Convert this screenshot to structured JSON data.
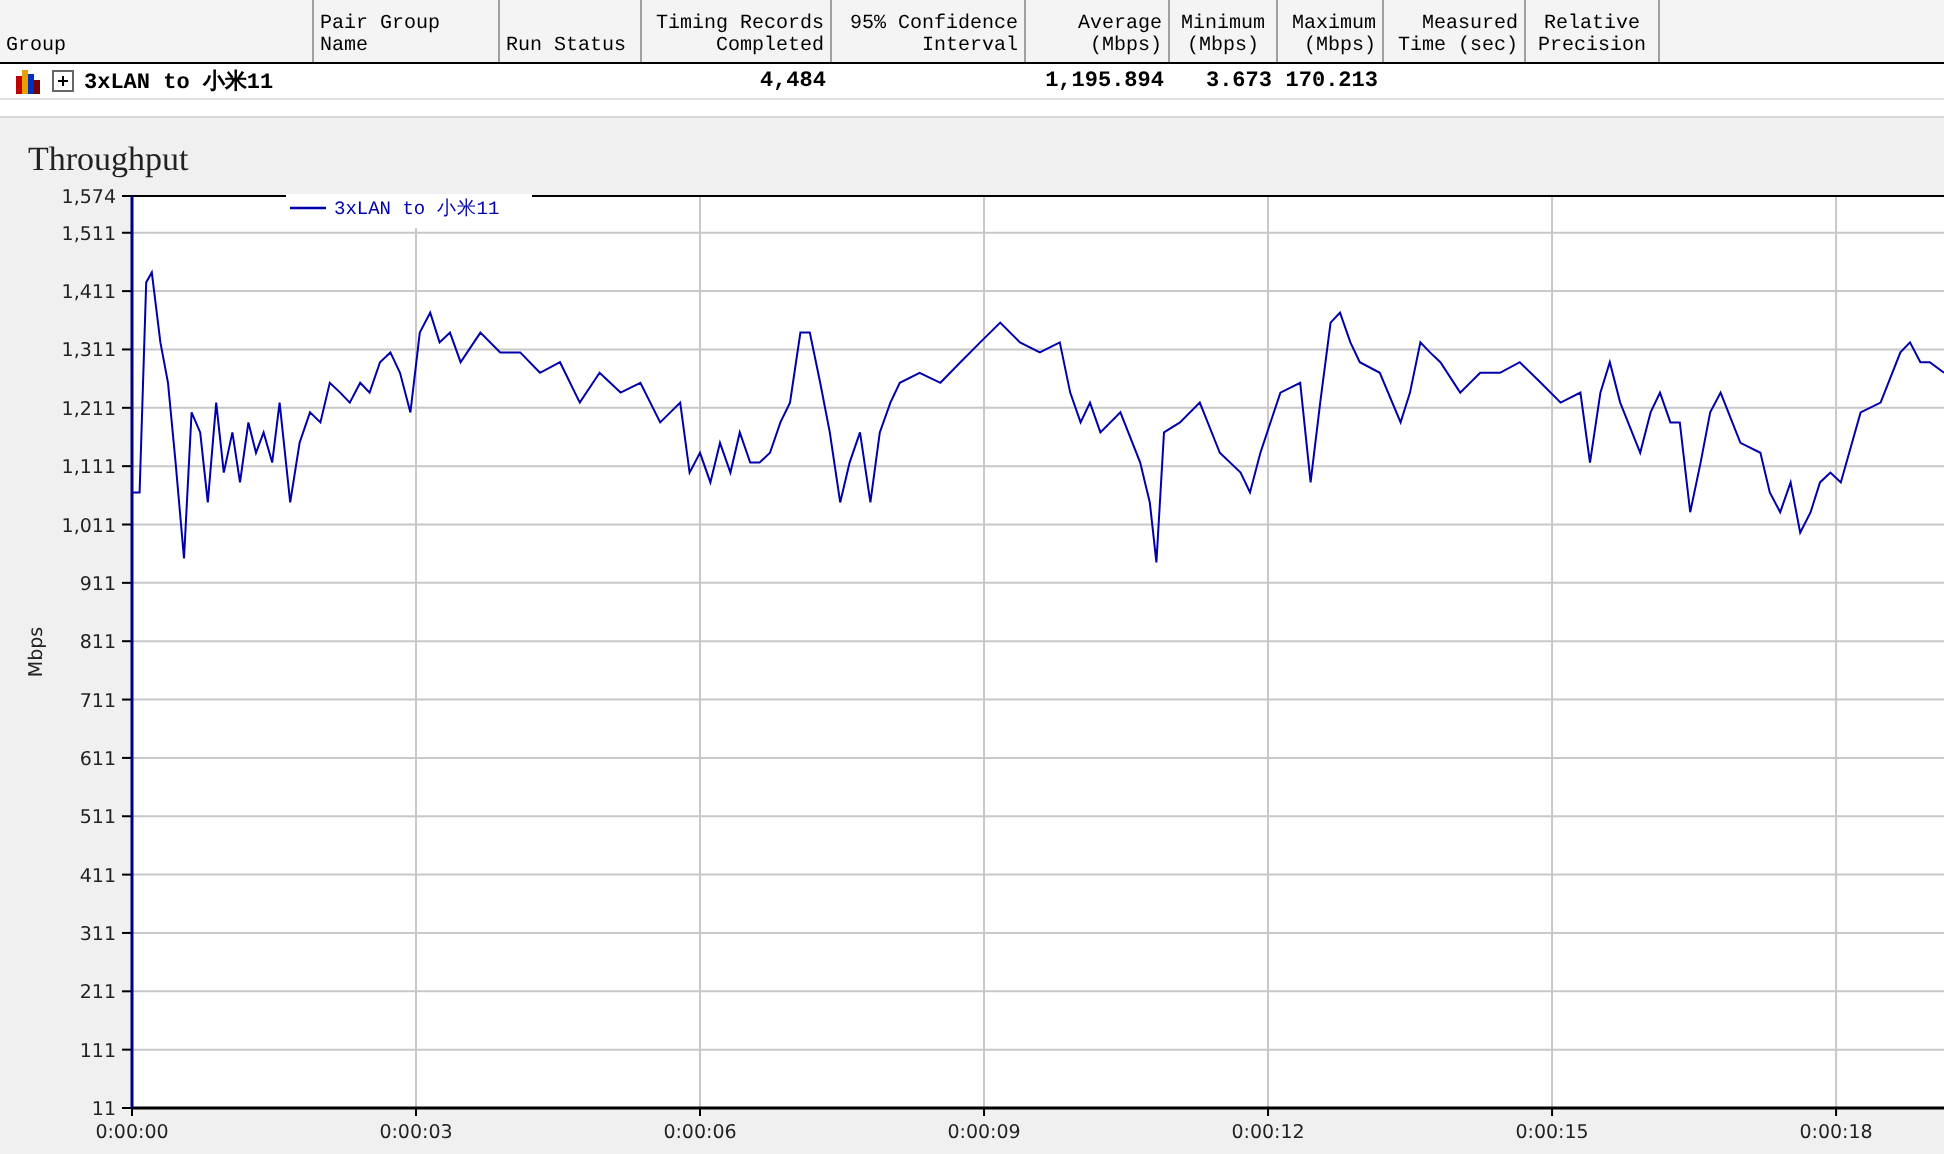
{
  "table": {
    "columns": [
      {
        "label": "Group"
      },
      {
        "label": "Pair Group\nName"
      },
      {
        "label": "Run Status"
      },
      {
        "label": "Timing Records\nCompleted"
      },
      {
        "label": "95% Confidence\nInterval"
      },
      {
        "label": "Average\n(Mbps)"
      },
      {
        "label": "Minimum\n(Mbps)"
      },
      {
        "label": "Maximum\n(Mbps)"
      },
      {
        "label": "Measured\nTime (sec)"
      },
      {
        "label": "Relative\nPrecision"
      }
    ],
    "rows": [
      {
        "group": "3xLAN to 小米11",
        "expanded": false,
        "timing_records": "4,484",
        "average": "1,195.894",
        "minimum": "3.673",
        "maximum": "170.213"
      }
    ]
  },
  "chart": {
    "chart_data": {
      "type": "line",
      "title": "Throughput",
      "ylabel": "Mbps",
      "grid": true,
      "x": [
        0,
        0.08,
        0.15,
        0.21,
        0.3,
        0.38,
        0.46,
        0.55,
        0.63,
        0.72,
        0.8,
        0.89,
        0.97,
        1.06,
        1.14,
        1.23,
        1.31,
        1.39,
        1.48,
        1.56,
        1.67,
        1.77,
        1.88,
        1.99,
        2.09,
        2.2,
        2.3,
        2.41,
        2.51,
        2.62,
        2.73,
        2.83,
        2.94,
        3.04,
        3.15,
        3.25,
        3.36,
        3.47,
        3.68,
        3.89,
        4.1,
        4.31,
        4.52,
        4.73,
        4.94,
        5.16,
        5.37,
        5.58,
        5.79,
        5.89,
        6,
        6.11,
        6.21,
        6.32,
        6.42,
        6.53,
        6.63,
        6.74,
        6.85,
        6.95,
        7.06,
        7.16,
        7.27,
        7.37,
        7.48,
        7.58,
        7.69,
        7.8,
        7.9,
        8.01,
        8.11,
        8.32,
        8.54,
        8.75,
        8.96,
        9.17,
        9.38,
        9.59,
        9.8,
        9.91,
        10.02,
        10.12,
        10.23,
        10.44,
        10.65,
        10.75,
        10.82,
        10.9,
        11.07,
        11.28,
        11.49,
        11.71,
        11.81,
        11.92,
        12.13,
        12.34,
        12.45,
        12.55,
        12.66,
        12.76,
        12.87,
        12.97,
        13.18,
        13.4,
        13.5,
        13.61,
        13.71,
        13.82,
        14.03,
        14.24,
        14.45,
        14.66,
        14.88,
        15.09,
        15.3,
        15.4,
        15.51,
        15.61,
        15.72,
        15.93,
        16.04,
        16.14,
        16.25,
        16.35,
        16.46,
        16.57,
        16.67,
        16.78,
        16.99,
        17.2,
        17.3,
        17.41,
        17.52,
        17.62,
        17.73,
        17.83,
        17.94,
        18.05,
        18.26,
        18.47,
        18.68,
        18.78,
        18.89,
        18.99,
        19.14
      ],
      "series": [
        {
          "name": "3xLAN to 小米11",
          "color": "#0000aa",
          "values": [
            1066,
            1066,
            1426,
            1443,
            1323,
            1254,
            1117,
            953,
            1203,
            1169,
            1049,
            1220,
            1100,
            1169,
            1083,
            1186,
            1134,
            1169,
            1117,
            1220,
            1049,
            1151,
            1203,
            1186,
            1254,
            1237,
            1220,
            1254,
            1237,
            1289,
            1306,
            1271,
            1203,
            1340,
            1374,
            1323,
            1340,
            1289,
            1340,
            1306,
            1306,
            1271,
            1289,
            1220,
            1271,
            1237,
            1254,
            1186,
            1220,
            1100,
            1134,
            1083,
            1151,
            1100,
            1169,
            1117,
            1117,
            1134,
            1186,
            1220,
            1340,
            1340,
            1254,
            1169,
            1049,
            1117,
            1169,
            1049,
            1169,
            1220,
            1254,
            1271,
            1254,
            1289,
            1323,
            1357,
            1323,
            1306,
            1323,
            1237,
            1186,
            1220,
            1169,
            1203,
            1117,
            1049,
            946,
            1169,
            1186,
            1220,
            1134,
            1100,
            1066,
            1134,
            1237,
            1254,
            1083,
            1220,
            1357,
            1374,
            1323,
            1289,
            1271,
            1186,
            1237,
            1323,
            1306,
            1289,
            1237,
            1271,
            1271,
            1289,
            1254,
            1220,
            1237,
            1117,
            1237,
            1289,
            1220,
            1134,
            1203,
            1237,
            1186,
            1186,
            1032,
            1117,
            1203,
            1237,
            1151,
            1134,
            1066,
            1032,
            1083,
            997,
            1032,
            1083,
            1100,
            1083,
            1203,
            1220,
            1306,
            1323,
            1289,
            1289,
            1271
          ]
        }
      ],
      "xlim": [
        0,
        19.14
      ],
      "ylim": [
        11,
        1574
      ],
      "xticks": [
        {
          "value": 0,
          "label": "0:00:00"
        },
        {
          "value": 3,
          "label": "0:00:03"
        },
        {
          "value": 6,
          "label": "0:00:06"
        },
        {
          "value": 9,
          "label": "0:00:09"
        },
        {
          "value": 12,
          "label": "0:00:12"
        },
        {
          "value": 15,
          "label": "0:00:15"
        },
        {
          "value": 18,
          "label": "0:00:18"
        }
      ],
      "yticks": [
        {
          "value": 11,
          "label": "11"
        },
        {
          "value": 111,
          "label": "111"
        },
        {
          "value": 211,
          "label": "211"
        },
        {
          "value": 311,
          "label": "311"
        },
        {
          "value": 411,
          "label": "411"
        },
        {
          "value": 511,
          "label": "511"
        },
        {
          "value": 611,
          "label": "611"
        },
        {
          "value": 711,
          "label": "711"
        },
        {
          "value": 811,
          "label": "811"
        },
        {
          "value": 911,
          "label": "911"
        },
        {
          "value": 1011,
          "label": "1,011"
        },
        {
          "value": 1111,
          "label": "1,111"
        },
        {
          "value": 1211,
          "label": "1,211"
        },
        {
          "value": 1311,
          "label": "1,311"
        },
        {
          "value": 1411,
          "label": "1,411"
        },
        {
          "value": 1511,
          "label": "1,511"
        },
        {
          "value": 1574,
          "label": "1,574"
        }
      ]
    }
  }
}
